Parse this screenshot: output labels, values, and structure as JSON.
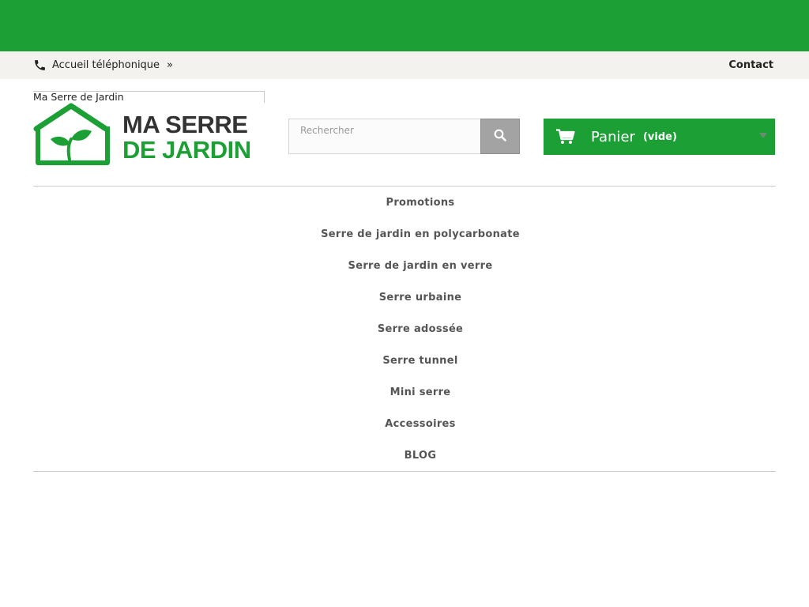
{
  "topbar": {
    "phone_label": "Accueil téléphonique",
    "phone_chevron": "»",
    "contact_label": "Contact"
  },
  "logo": {
    "alt_text": "Ma Serre de Jardin",
    "line1": "MA SERRE",
    "line2": "DE JARDIN"
  },
  "search": {
    "placeholder": "Rechercher",
    "value": ""
  },
  "cart": {
    "title": "Panier",
    "status": "(vide)"
  },
  "menu": {
    "items": [
      "Promotions",
      "Serre de jardin en polycarbonate",
      "Serre de jardin en verre",
      "Serre urbaine",
      "Serre adossée",
      "Serre tunnel",
      "Mini serre",
      "Accessoires",
      "BLOG"
    ]
  },
  "colors": {
    "brand_green": "#1ca035",
    "nav_background": "#f4f2ee",
    "search_button": "#a3a3a3"
  },
  "icons": {
    "phone": "phone-icon",
    "search": "search-icon",
    "cart": "shopping-cart-icon",
    "caret": "caret-down-icon"
  }
}
